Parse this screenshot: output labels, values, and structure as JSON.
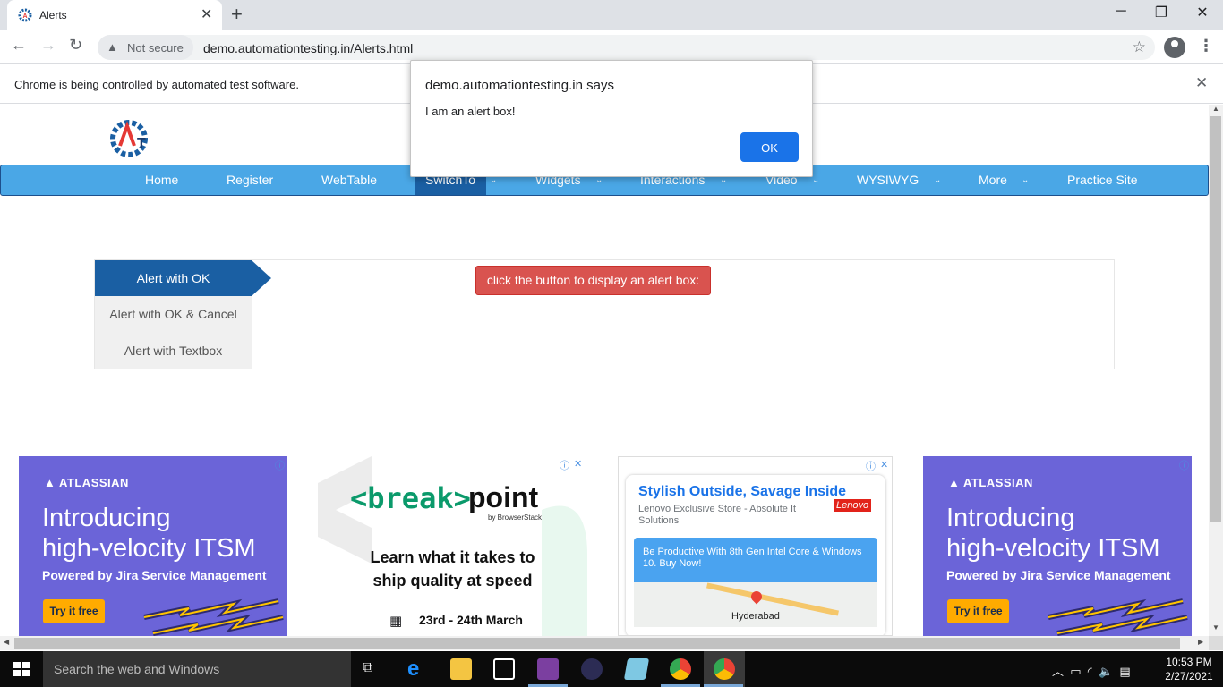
{
  "browser": {
    "tab_title": "Alerts",
    "not_secure": "Not secure",
    "url": "demo.automationtesting.in/Alerts.html",
    "infobar_text": "Chrome is being controlled by automated test software."
  },
  "nav": {
    "items": [
      "Home",
      "Register",
      "WebTable",
      "SwitchTo",
      "Widgets",
      "Interactions",
      "Video",
      "WYSIWYG",
      "More",
      "Practice Site"
    ],
    "active": "SwitchTo"
  },
  "alerts_panel": {
    "tabs": [
      "Alert with OK",
      "Alert with OK & Cancel",
      "Alert with Textbox"
    ],
    "button_label": "click the button to display an alert box:"
  },
  "dialog": {
    "title": "demo.automationtesting.in says",
    "message": "I am an alert box!",
    "ok_label": "OK"
  },
  "ads": {
    "atlassian": {
      "brand": "ATLASSIAN",
      "headline_1": "Introducing",
      "headline_2": "high-velocity ITSM",
      "sub": "Powered by Jira Service Management",
      "cta": "Try it free"
    },
    "breakpoint": {
      "logo_1": "<break>",
      "logo_2": "point",
      "by": "by BrowserStack",
      "line_1": "Learn what it takes to",
      "line_2": "ship quality at speed",
      "date": "23rd - 24th March"
    },
    "lenovo": {
      "headline": "Stylish Outside, Savage Inside",
      "sub": "Lenovo Exclusive Store - Absolute It Solutions",
      "logo": "Lenovo",
      "promo": "Be Productive With 8th Gen Intel Core & Windows 10. Buy Now!",
      "city": "Hyderabad"
    }
  },
  "taskbar": {
    "search_placeholder": "Search the web and Windows",
    "time": "10:53 PM",
    "date": "2/27/2021"
  }
}
